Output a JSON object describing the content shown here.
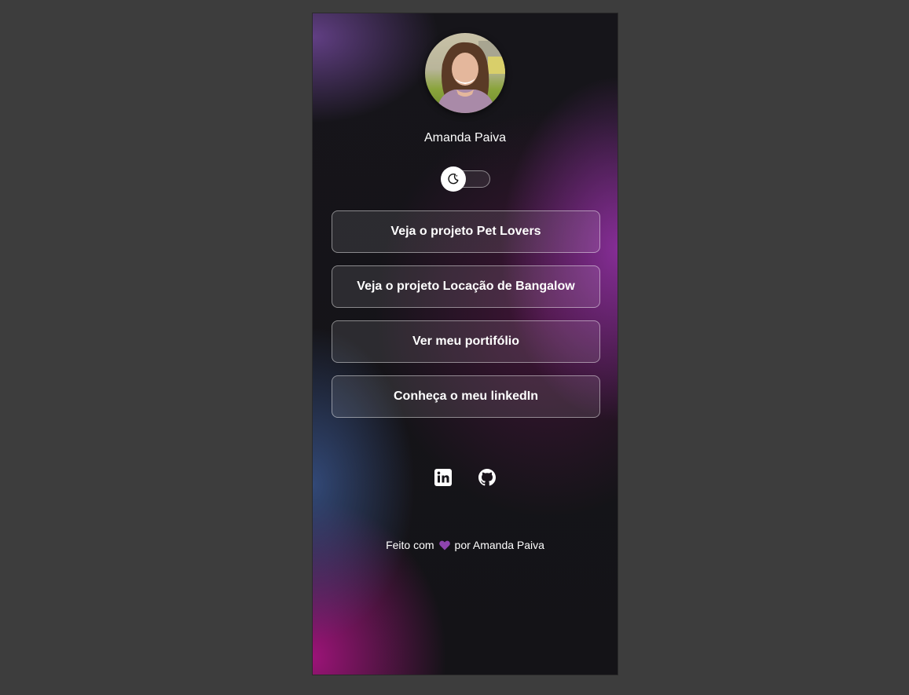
{
  "profile": {
    "name": "Amanda Paiva",
    "avatar_icon": "profile-photo"
  },
  "theme_toggle": {
    "icon": "moon-icon",
    "state": "dark"
  },
  "links": [
    {
      "label": "Veja o projeto Pet Lovers"
    },
    {
      "label": "Veja o projeto Locação de Bangalow"
    },
    {
      "label": "Ver meu portifólio"
    },
    {
      "label": "Conheça o meu linkedIn"
    }
  ],
  "socials": [
    {
      "icon": "linkedin-icon"
    },
    {
      "icon": "github-icon"
    }
  ],
  "footer": {
    "prefix": "Feito com",
    "heart_icon": "purple-heart-icon",
    "suffix": "por Amanda Paiva"
  },
  "colors": {
    "page_background": "#3d3d3d",
    "card_background": "#141317",
    "accent_purple": "#9b30c0",
    "accent_pink": "#aa1482",
    "accent_blue": "#3c5a96",
    "heart": "#8e44ad"
  }
}
